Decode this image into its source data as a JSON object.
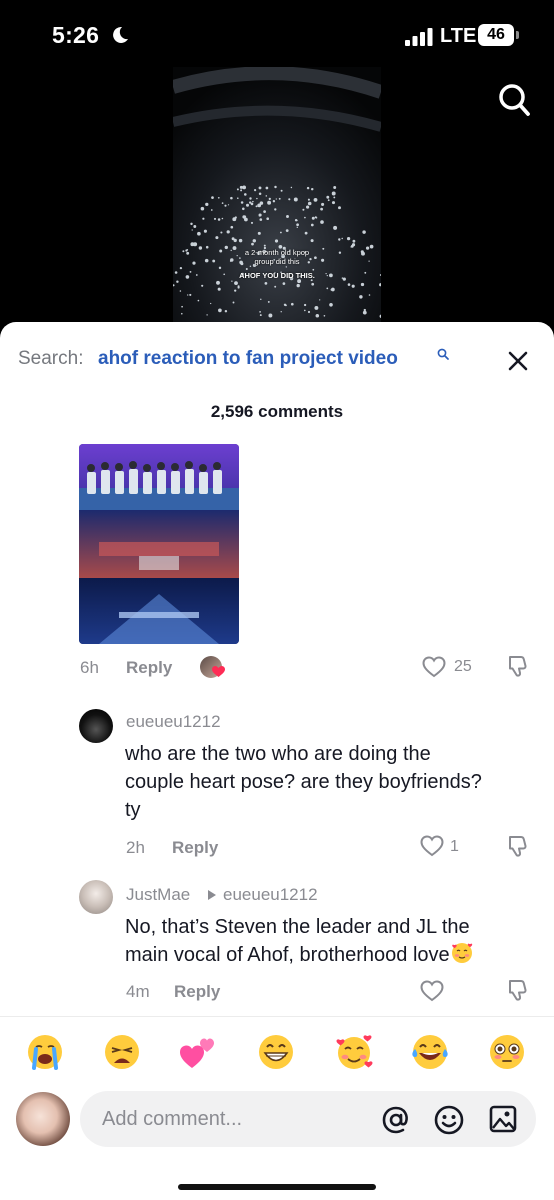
{
  "status_bar": {
    "time": "5:26",
    "network": "LTE",
    "battery": "46",
    "icons": [
      "moon-icon",
      "signal-icon",
      "battery-icon"
    ]
  },
  "video": {
    "caption_line1": "a 2-month old kpop",
    "caption_line2": "group did this",
    "caption_line3": "AHOF YOU DID THIS."
  },
  "header": {
    "search_prefix": "Search:",
    "search_query": "ahof reaction to fan project video",
    "icons": [
      "search-icon",
      "close-icon"
    ]
  },
  "comments_count": "2,596 comments",
  "comments": [
    {
      "type": "image",
      "time": "6h",
      "reply_label": "Reply",
      "likes": "25"
    },
    {
      "username": "eueueu1212",
      "text": "who are the two who are doing the couple heart pose? are they boyfriends? ty",
      "line1": "who are the two who are doing the",
      "line2": "couple heart pose? are they boyfriends?",
      "line3": "ty",
      "time": "2h",
      "reply_label": "Reply",
      "likes": "1"
    },
    {
      "username": "JustMae",
      "reply_to": "eueueu1212",
      "line1": "No, that’s Steven the leader and JL the",
      "line2": "main vocal of Ahof, brotherhood love",
      "time": "4m",
      "reply_label": "Reply"
    }
  ],
  "emoji_bar": [
    "😭",
    "😩",
    "💕",
    "😁",
    "🥰",
    "😂",
    "😳"
  ],
  "input": {
    "placeholder": "Add comment...",
    "icons": [
      "at-icon",
      "smile-icon",
      "image-icon"
    ]
  },
  "colors": {
    "link": "#2b5db9",
    "muted": "#8a8b91",
    "text": "#161823",
    "sheet": "#ffffff",
    "input_bg": "#f1f1f2"
  }
}
